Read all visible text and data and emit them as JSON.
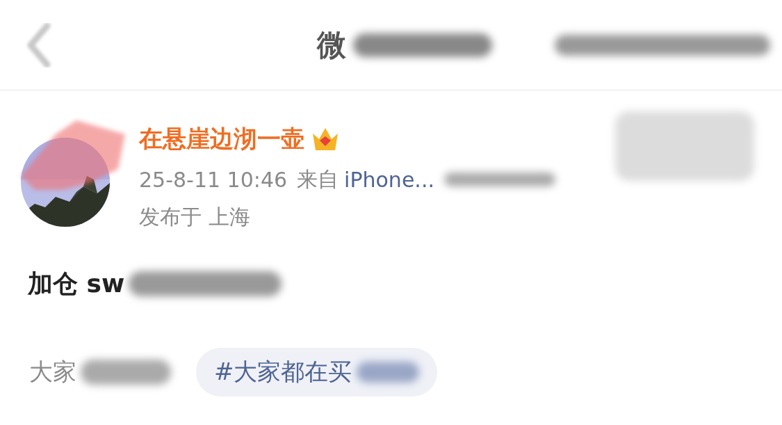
{
  "nav": {
    "title": "微"
  },
  "post": {
    "author": "在悬崖边沏一壶",
    "time": "25-8-11 10:46",
    "source_prefix": "来自",
    "source": "iPhone...",
    "location": "发布于 上海",
    "body": "加仓 sw",
    "topic_label": "大家",
    "topic_tag": "#大家都在买"
  }
}
